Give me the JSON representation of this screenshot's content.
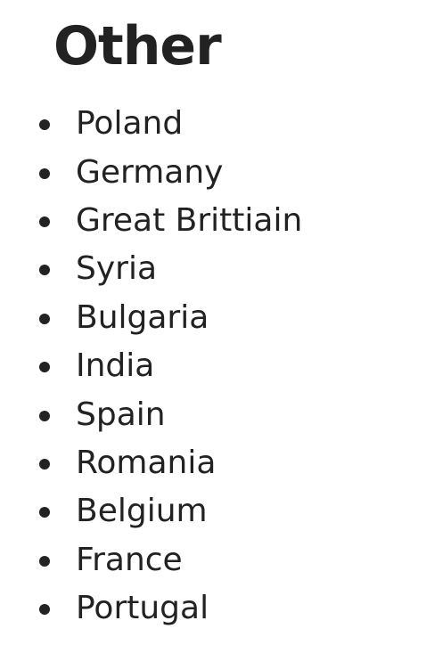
{
  "section": {
    "heading": "Other"
  },
  "countries": [
    "Poland",
    "Germany",
    "Great Brittiain",
    "Syria",
    "Bulgaria",
    "India",
    "Spain",
    "Romania",
    "Belgium",
    "France",
    "Portugal"
  ],
  "colors": {
    "text": "#222222",
    "background": "#ffffff"
  }
}
